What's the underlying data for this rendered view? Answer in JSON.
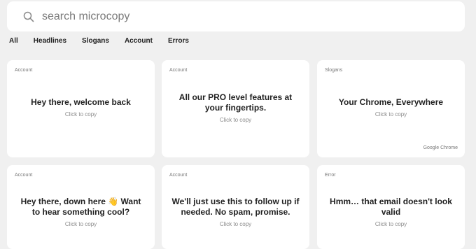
{
  "search": {
    "placeholder": "search microcopy"
  },
  "tabs": [
    "All",
    "Headlines",
    "Slogans",
    "Account",
    "Errors"
  ],
  "cards": [
    {
      "category": "Account",
      "text": "Hey there, welcome back",
      "action": "Click to copy"
    },
    {
      "category": "Account",
      "text": "All our PRO level features at your fingertips.",
      "action": "Click to copy"
    },
    {
      "category": "Slogans",
      "text": "Your Chrome, Everywhere",
      "action": "Click to copy",
      "source": "Google Chrome"
    },
    {
      "category": "Account",
      "text": "Hey there, down here 👋 Want to hear something cool?",
      "action": "Click to copy"
    },
    {
      "category": "Account",
      "text": "We'll just use this to follow up if needed. No spam, promise.",
      "action": "Click to copy"
    },
    {
      "category": "Error",
      "text": "Hmm… that email doesn't look valid",
      "action": "Click to copy"
    }
  ]
}
